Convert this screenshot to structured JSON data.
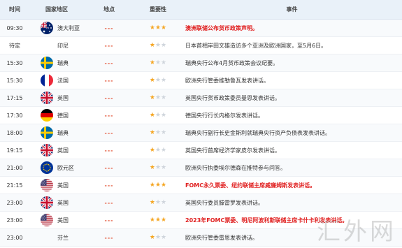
{
  "headers": {
    "time": "时间",
    "country": "国家地区",
    "place": "地点",
    "importance": "重要性",
    "event": "事件"
  },
  "rows": [
    {
      "time": "09:30",
      "country": "澳大利亚",
      "flag": "australia-flag-icon",
      "place": "---",
      "stars": 3,
      "event": "澳洲联储公布货币政策声明。",
      "highlight": true
    },
    {
      "time": "待定",
      "country": "印尼",
      "flag": "",
      "place": "---",
      "stars": 1,
      "event": "日本首相岸田文雄造访多个亚洲及欧洲国家，至5月6日。",
      "highlight": false
    },
    {
      "time": "15:30",
      "country": "瑞典",
      "flag": "sweden-flag-icon",
      "place": "---",
      "stars": 1,
      "event": "瑞典央行公布4月货币政策会议纪要。",
      "highlight": false
    },
    {
      "time": "15:30",
      "country": "法国",
      "flag": "france-flag-icon",
      "place": "---",
      "stars": 1,
      "event": "欧洲央行管委维勒鲁瓦发表讲话。",
      "highlight": false
    },
    {
      "time": "17:15",
      "country": "英国",
      "flag": "uk-flag-icon",
      "place": "---",
      "stars": 1,
      "event": "英国央行货币政策委员曼恩发表讲话。",
      "highlight": false
    },
    {
      "time": "17:30",
      "country": "德国",
      "flag": "germany-flag-icon",
      "place": "---",
      "stars": 1,
      "event": "德国央行行长内格尔发表讲话。",
      "highlight": false
    },
    {
      "time": "18:00",
      "country": "瑞典",
      "flag": "sweden-flag-icon",
      "place": "---",
      "stars": 1,
      "event": "瑞典央行副行长史金斯利就瑞典央行资产负债表发表讲话。",
      "highlight": false
    },
    {
      "time": "19:15",
      "country": "英国",
      "flag": "uk-flag-icon",
      "place": "---",
      "stars": 1,
      "event": "英国央行首席经济学家皮尔发表讲话。",
      "highlight": false
    },
    {
      "time": "21:00",
      "country": "欧元区",
      "flag": "eu-flag-icon",
      "place": "---",
      "stars": 1,
      "event": "欧洲央行执委埃尔德森在推特参与问答。",
      "highlight": false
    },
    {
      "time": "21:15",
      "country": "美国",
      "flag": "usa-flag-icon",
      "place": "---",
      "stars": 3,
      "event": "FOMC永久票委、纽约联储主席威廉姆斯发表讲话。",
      "highlight": true
    },
    {
      "time": "23:00",
      "country": "英国",
      "flag": "uk-flag-icon",
      "place": "---",
      "stars": 1,
      "event": "英国央行委员滕雷罗发表讲话。",
      "highlight": false
    },
    {
      "time": "23:00",
      "country": "美国",
      "flag": "usa-flag-icon",
      "place": "---",
      "stars": 3,
      "event": "2023年FOMC票委、明尼阿波利斯联储主席卡什卡利发表讲话。",
      "highlight": true
    },
    {
      "time": "23:00",
      "country": "芬兰",
      "flag": "",
      "place": "---",
      "stars": 1,
      "event": "欧洲央行管委雷恩发表讲话。",
      "highlight": false
    }
  ],
  "watermark": "汇外网",
  "colors": {
    "star_on": "#f5a623",
    "star_off": "#cfd5dc",
    "highlight": "#e02020",
    "place": "#e24c2e",
    "header_bg": "#e9f1f9"
  }
}
